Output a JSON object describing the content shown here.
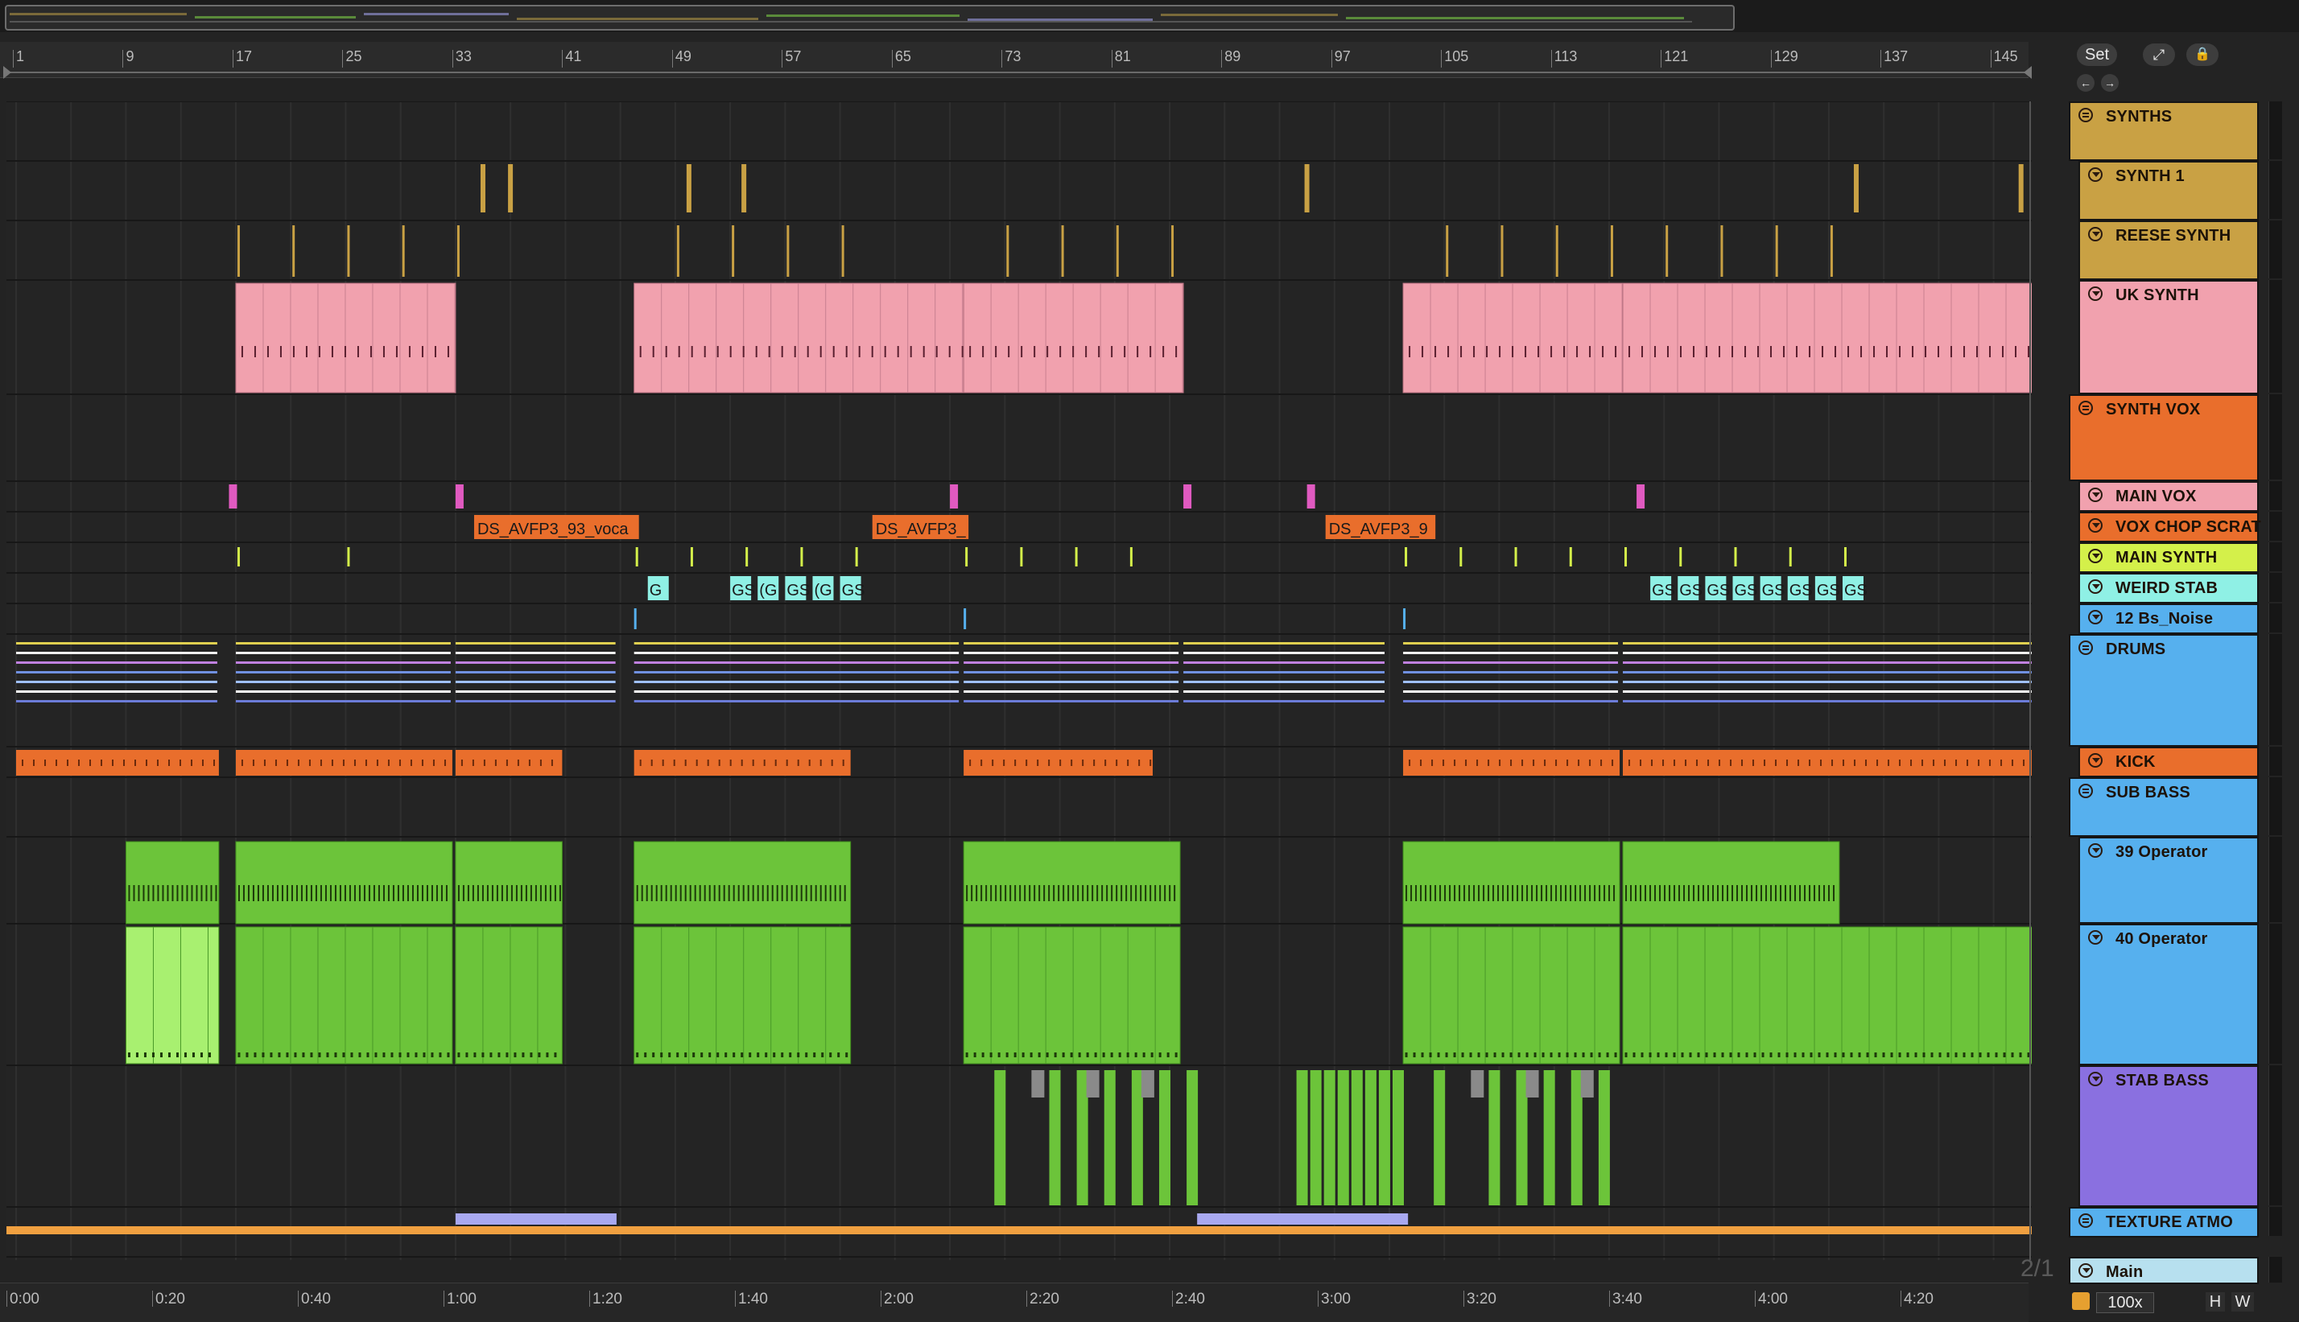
{
  "app": {
    "title": "Ableton Live Arrangement View"
  },
  "bar_ruler": {
    "ticks": [
      "1",
      "9",
      "17",
      "25",
      "33",
      "41",
      "49",
      "57",
      "65",
      "73",
      "81",
      "89",
      "97",
      "105",
      "113",
      "121",
      "129",
      "137",
      "145"
    ]
  },
  "time_ruler": {
    "ticks": [
      "0:00",
      "0:20",
      "0:40",
      "1:00",
      "1:20",
      "1:40",
      "2:00",
      "2:20",
      "2:40",
      "3:00",
      "3:20",
      "3:40",
      "4:00",
      "4:20"
    ]
  },
  "controls": {
    "set_label": "Set",
    "expand_icon": "expand-arrows-icon",
    "lock_icon": "lock-icon",
    "back_icon": "arrow-left-icon",
    "forward_icon": "arrow-right-icon",
    "grid_label": "2/1",
    "zoom_value": "100x",
    "h_label": "H",
    "w_label": "W"
  },
  "tracks": [
    {
      "name": "SYNTHS",
      "type": "group",
      "color": "#c9a144"
    },
    {
      "name": "SYNTH 1",
      "type": "midi",
      "color": "#c9a144"
    },
    {
      "name": "REESE SYNTH",
      "type": "midi",
      "color": "#c9a144"
    },
    {
      "name": "UK SYNTH",
      "type": "midi",
      "color": "#f1a1ae"
    },
    {
      "name": "SYNTH VOX",
      "type": "group",
      "color": "#e96e2c"
    },
    {
      "name": "MAIN VOX",
      "type": "audio",
      "color": "#f1a1ae"
    },
    {
      "name": "VOX CHOP SCRAT",
      "type": "audio",
      "color": "#e96e2c"
    },
    {
      "name": "MAIN SYNTH",
      "type": "audio",
      "color": "#d4f04a"
    },
    {
      "name": "WEIRD STAB",
      "type": "audio",
      "color": "#8ff0e5"
    },
    {
      "name": "12 Bs_Noise",
      "type": "audio",
      "color": "#56b0ee"
    },
    {
      "name": "DRUMS",
      "type": "group",
      "color": "#56b0ee"
    },
    {
      "name": "KICK",
      "type": "audio",
      "color": "#e96e2c"
    },
    {
      "name": "SUB BASS",
      "type": "group",
      "color": "#56b0ee"
    },
    {
      "name": "39 Operator",
      "type": "midi",
      "color": "#56b0ee"
    },
    {
      "name": "40 Operator",
      "type": "midi",
      "color": "#56b0ee"
    },
    {
      "name": "STAB BASS",
      "type": "midi",
      "color": "#8a70e0"
    },
    {
      "name": "TEXTURE ATMO",
      "type": "group",
      "color": "#56b0ee"
    },
    {
      "name": "Main",
      "type": "main",
      "color": "#b7e0ef"
    }
  ],
  "clips": {
    "vocal_1": "DS_AVFP3_93_voca",
    "vocal_2": "DS_AVFP3_",
    "vocal_3": "DS_AVFP3_9",
    "stab_label": "GS",
    "stab_short": "G",
    "stab_paren": "(G"
  }
}
